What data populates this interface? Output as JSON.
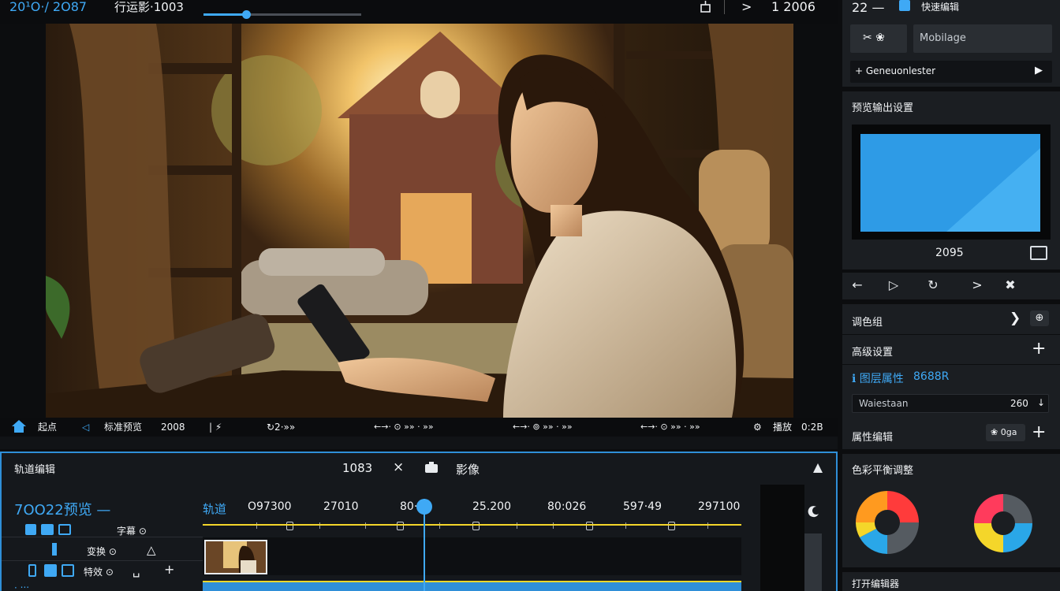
{
  "topbar": {
    "timecode": "20¹O·/ 2O87",
    "project": "行运影·1003",
    "scrub_progress": 0.27,
    "frame": "1 2006",
    "playback_icon": "chevron-right-icon",
    "tool_icon": "crop-icon"
  },
  "preview": {
    "scene": "woman-reading-tablet-by-window"
  },
  "transport": {
    "home_label": "起点",
    "prev_label": "标准预览",
    "time": "2008",
    "pause_label": "| ⚡",
    "rate": "↻2·»»",
    "marker_1": "←→· ⊙ »» · »»",
    "marker_2": "←→· ⊚ »» · »»",
    "marker_3": "←→· ⊙ »» · »»",
    "end_label": "播放",
    "duration": "0:2B"
  },
  "timeline": {
    "panel_title": "轨道编辑",
    "count": "1083",
    "close": "×",
    "camera_label": "影像",
    "sequence_title": "7OO22预览 —",
    "track_label": "轨道",
    "ruler": [
      "O97300",
      "27010",
      "80·00",
      "25.200",
      "80:026",
      "597·49",
      "297100"
    ],
    "row_labels": {
      "r1": "字幕 ⊙",
      "r2": "变换 ⊙",
      "r3": "△",
      "r4": "特效 ⊙",
      "r5": "␣",
      "r6": "+"
    },
    "audio_label": "· ‧‧‧"
  },
  "right": {
    "top_num": "22 —",
    "top_title": "快速编辑",
    "layer_btn": "✂ ❀",
    "search_placeholder": "Mobilage",
    "add_transition": "+ Geneuonlester",
    "preview_title": "预览输出设置",
    "preview_res": "2095",
    "nav_prev": "←",
    "nav_play": "▷",
    "nav_loop": "↻",
    "nav_next": ">",
    "nav_cut": "✖",
    "prop_1": "调色组",
    "prop_2": "高级设置",
    "prop_3": "ℹ 图层属性",
    "prop_3_hex": "8688R",
    "field_value": "Waiestaan",
    "field_num": "260",
    "prop_4": "属性编辑",
    "prop_4_btn": "❀ 0ga",
    "wheel_title": "色彩平衡调整",
    "bottom_title": "打开编辑器"
  },
  "colors": {
    "accent": "#3fa9f5",
    "yellow": "#f4d62a",
    "panel": "#1b1e22"
  }
}
